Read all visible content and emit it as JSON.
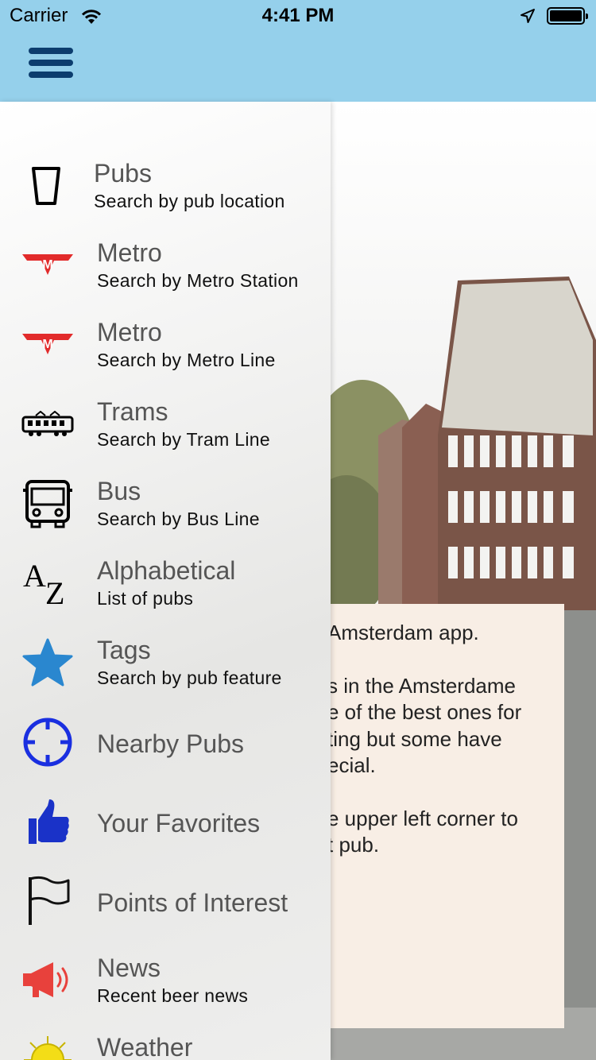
{
  "status_bar": {
    "carrier": "Carrier",
    "time": "4:41 PM"
  },
  "menu": [
    {
      "title": "Pubs",
      "subtitle": "Search by pub location",
      "icon": "beer-glass-icon"
    },
    {
      "title": "Metro",
      "subtitle": "Search by Metro Station",
      "icon": "metro-logo-icon"
    },
    {
      "title": "Metro",
      "subtitle": "Search by Metro Line",
      "icon": "metro-logo-icon"
    },
    {
      "title": "Trams",
      "subtitle": "Search by Tram Line",
      "icon": "tram-icon"
    },
    {
      "title": "Bus",
      "subtitle": "Search by Bus Line",
      "icon": "bus-icon"
    },
    {
      "title": "Alphabetical",
      "subtitle": "List of pubs",
      "icon": "az-icon"
    },
    {
      "title": "Tags",
      "subtitle": "Search by pub feature",
      "icon": "star-icon"
    },
    {
      "title": "Nearby Pubs",
      "subtitle": "",
      "icon": "crosshair-icon"
    },
    {
      "title": "Your Favorites",
      "subtitle": "",
      "icon": "thumbs-up-icon"
    },
    {
      "title": "Points of Interest",
      "subtitle": "",
      "icon": "flag-icon"
    },
    {
      "title": "News",
      "subtitle": "Recent beer news",
      "icon": "megaphone-icon"
    },
    {
      "title": "Weather",
      "subtitle": "",
      "icon": "sun-icon"
    }
  ],
  "az_glyph": "AZ",
  "info_text": {
    "line1": "Amsterdam app.",
    "line2": "s in the Amsterdame",
    "line3": "e of the best ones for",
    "line4": "ting but some have",
    "line5": "ecial.",
    "line6": "e upper left corner to",
    "line7": "t pub."
  },
  "colors": {
    "header": "#95d0eb",
    "hamburger": "#0c3d6e",
    "metro_red": "#e22b2b",
    "star_blue": "#2a87cf",
    "crosshair_blue": "#1a2fe0",
    "thumb_blue": "#1a32c8",
    "megaphone_red": "#e8413c",
    "sun_yellow": "#f3dd17"
  }
}
